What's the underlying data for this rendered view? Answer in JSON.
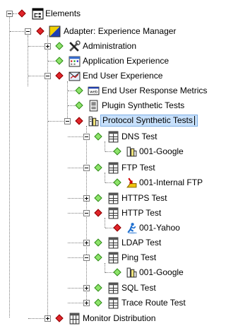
{
  "tree": {
    "root_label": "Elements",
    "adapter_label": "Adapter: Experience Manager",
    "administration_label": "Administration",
    "application_experience_label": "Application Experience",
    "end_user_experience_label": "End User Experience",
    "eu_response_metrics_label": "End User Response Metrics",
    "plugin_synthetic_tests_label": "Plugin Synthetic Tests",
    "protocol_synthetic_tests_label": "Protocol Synthetic Tests",
    "dns_test_label": "DNS Test",
    "dns_child_label": "001-Google",
    "ftp_test_label": "FTP Test",
    "ftp_child_label": "001-Internal FTP",
    "https_test_label": "HTTPS Test",
    "http_test_label": "HTTP Test",
    "http_child_label": "001-Yahoo",
    "ldap_test_label": "LDAP Test",
    "ping_test_label": "Ping Test",
    "ping_child_label": "001-Google",
    "sql_test_label": "SQL Test",
    "trace_route_test_label": "Trace Route Test",
    "monitor_distribution_label": "Monitor Distribution"
  },
  "colors": {
    "status_ok": "#8ee36b",
    "status_alert": "#e0242a",
    "selection_bg": "#c7e0fb"
  },
  "icons": {
    "root": "window-tree-icon",
    "adapter": "adapter-flag-icon",
    "administration": "tools-icon",
    "application_experience": "calendar-app-icon",
    "end_user_experience": "envelope-icon",
    "eu_response_metrics": "web-monitor-icon",
    "plugin_synthetic_tests": "plugin-icon",
    "protocol_synthetic_tests": "protocol-icon",
    "test_group": "test-group-icon",
    "dns_child": "protocol-icon",
    "ftp_child": "ftp-icon",
    "http_child": "runner-icon",
    "ping_child": "protocol-icon",
    "monitor_distribution": "distribution-icon"
  }
}
